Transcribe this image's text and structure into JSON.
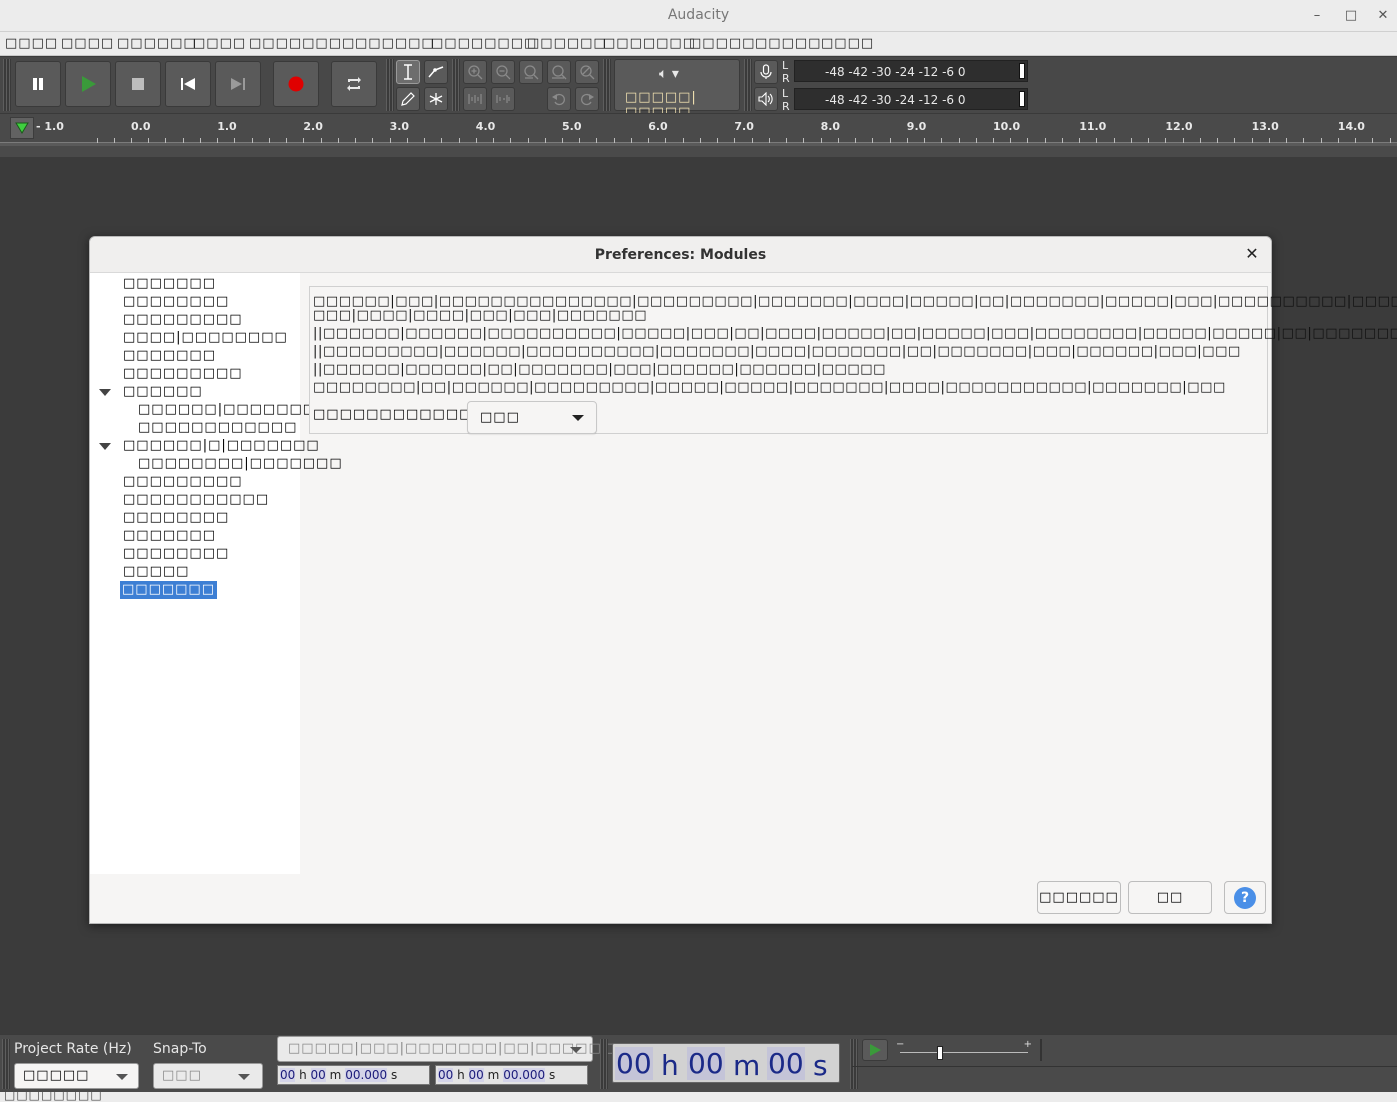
{
  "window": {
    "title": "Audacity",
    "minimize_glyph": "–",
    "maximize_glyph": "□",
    "close_glyph": "✕"
  },
  "menubar": {
    "items": [
      "□□□□",
      "□□□□",
      "□□□□□□",
      "□□□□",
      "□□□□□□□□",
      "□□□□□□",
      "□□□□□□□□",
      "□□□□□□",
      "□□□□□□□",
      "□□□□□",
      "□□□□□",
      "□□□□"
    ]
  },
  "toolbar": {
    "output_device_label": "□□□□□|□□□□□",
    "recording_meter_scale": "-48 -42   -30 -24   -12  -6   0",
    "playback_meter_scale": "-48 -42   -30 -24   -12  -6   0",
    "meter_l": "L",
    "meter_r": "R"
  },
  "ruler": {
    "labels": [
      "- 1.0",
      "0.0",
      "1.0",
      "2.0",
      "3.0",
      "4.0",
      "5.0",
      "6.0",
      "7.0",
      "8.0",
      "9.0",
      "10.0",
      "11.0",
      "12.0",
      "13.0",
      "14.0"
    ]
  },
  "dialog": {
    "title": "Preferences: Modules",
    "close_glyph": "✕",
    "tree": [
      {
        "label": "□□□□□□□",
        "level": 0
      },
      {
        "label": "□□□□□□□□",
        "level": 0
      },
      {
        "label": "□□□□□□□□□",
        "level": 0
      },
      {
        "label": "□□□□|□□□□□□□□",
        "level": 0
      },
      {
        "label": "□□□□□□□",
        "level": 0
      },
      {
        "label": "□□□□□□□□□",
        "level": 0
      },
      {
        "label": "□□□□□□",
        "level": 0,
        "expanded": true
      },
      {
        "label": "□□□□□□|□□□□□□□□□□□",
        "level": 1
      },
      {
        "label": "□□□□□□□□□□□□",
        "level": 1
      },
      {
        "label": "□□□□□□|□|□□□□□□□",
        "level": 0,
        "expanded": true
      },
      {
        "label": "□□□□□□□□|□□□□□□□",
        "level": 1
      },
      {
        "label": "□□□□□□□□□",
        "level": 0
      },
      {
        "label": "□□□□□□□□□□□",
        "level": 0
      },
      {
        "label": "□□□□□□□□",
        "level": 0
      },
      {
        "label": "□□□□□□□",
        "level": 0
      },
      {
        "label": "□□□□□□□□",
        "level": 0
      },
      {
        "label": "□□□□□",
        "level": 0
      },
      {
        "label": "□□□□□□□",
        "level": 0,
        "selected": true
      }
    ],
    "panel_lines": [
      "□□□□□□|□□□|□□□□□□□□□□□□□□□|□□□□□□□□□|□□□□□□□|□□□□|□□□□□|□□|□□□□□□□|□□□□□|□□□|□□□□□□□□□□|□□□□□□□",
      "□□□|□□□□|□□□□|□□□|□□□|□□□□□□□",
      "||□□□□□□|□□□□□□|□□□□□□□□□□|□□□□□|□□□|□□|□□□□|□□□□□|□□|□□□□□|□□□|□□□□□□□□|□□□□□|□□□□□|□□|□□□□□□□□□",
      "||□□□□□□□□□|□□□□□□|□□□□□□□□□□|□□□□□□□|□□□□|□□□□□□□|□□|□□□□□□□|□□□|□□□□□□|□□□|□□□",
      "||□□□□□□|□□□□□□|□□|□□□□□□□|□□□|□□□□□□|□□□□□□|□□□□□",
      "□□□□□□□□|□□|□□□□□□|□□□□□□□□□|□□□□□|□□□□□|□□□□□□□|□□□□|□□□□□□□□□□□|□□□□□□□|□□□"
    ],
    "mode_label": "□□□□□□□□□□□□□□□□□",
    "mode_value": "□□□",
    "cancel_label": "□□□□□□",
    "ok_label": "□□",
    "help_glyph": "?"
  },
  "selection_bar": {
    "project_rate_label": "Project Rate (Hz)",
    "snap_to_label": "Snap-To",
    "project_rate_value": "□□□□□",
    "snap_to_value": "□□□",
    "selection_mode_value": "□□□□□|□□□|□□□□□□□|□□|□□□□□□□□□□",
    "sel_start": {
      "h": "00",
      "m": "00",
      "s": "00.000"
    },
    "sel_end": {
      "h": "00",
      "m": "00",
      "s": "00.000"
    },
    "audio_position": {
      "h": "00",
      "m": "00",
      "s": "00"
    },
    "units": {
      "h": "h",
      "m": "m",
      "s": "s"
    }
  },
  "statusbar": {
    "text": "□□□□□□□□"
  }
}
